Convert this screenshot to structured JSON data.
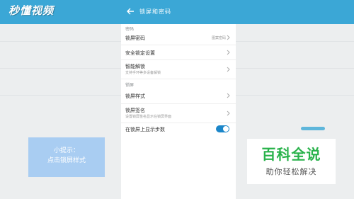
{
  "watermark": {
    "logo_text": "秒懂视频"
  },
  "tip": {
    "line1": "小提示：",
    "line2": "点击锁屏样式"
  },
  "phone": {
    "title": "锁屏和密码",
    "sections": [
      {
        "label": "密码"
      },
      {
        "label": "锁屏"
      }
    ],
    "rows": [
      {
        "title": "锁屏密码",
        "value": "图案密码"
      },
      {
        "title": "安全锁定设置"
      },
      {
        "title": "智能解锁",
        "subtitle": "支持手环等多设备解锁"
      },
      {
        "title": "锁屏样式"
      },
      {
        "title": "锁屏签名",
        "subtitle": "设置锁屏签名显示在锁屏界面"
      },
      {
        "title": "在锁屏上显示步数",
        "toggle_on": true
      }
    ]
  },
  "brand": {
    "main": "百科全说",
    "sub": "助你轻松解决"
  },
  "colors": {
    "header": "#3ba7d6",
    "tip": "#a9cdf2",
    "toggle": "#1b86c9",
    "brand_green": "#28b24a"
  }
}
